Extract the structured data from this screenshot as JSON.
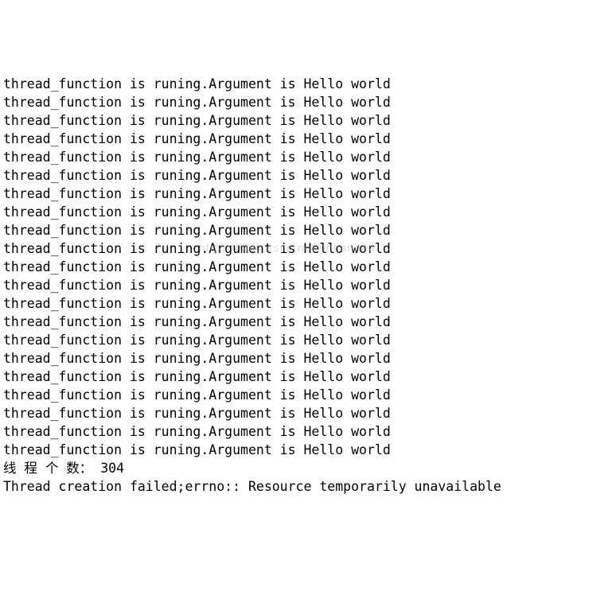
{
  "repeated_line": "thread_function is runing.Argument is Hello world",
  "repeat_count": 21,
  "count_label": "线 程 个 数： ",
  "count_value": "304",
  "error_line": "Thread creation failed;errno:: Resource temporarily unavailable",
  "watermark": "https://blog.csdn.net/hnhanpan"
}
